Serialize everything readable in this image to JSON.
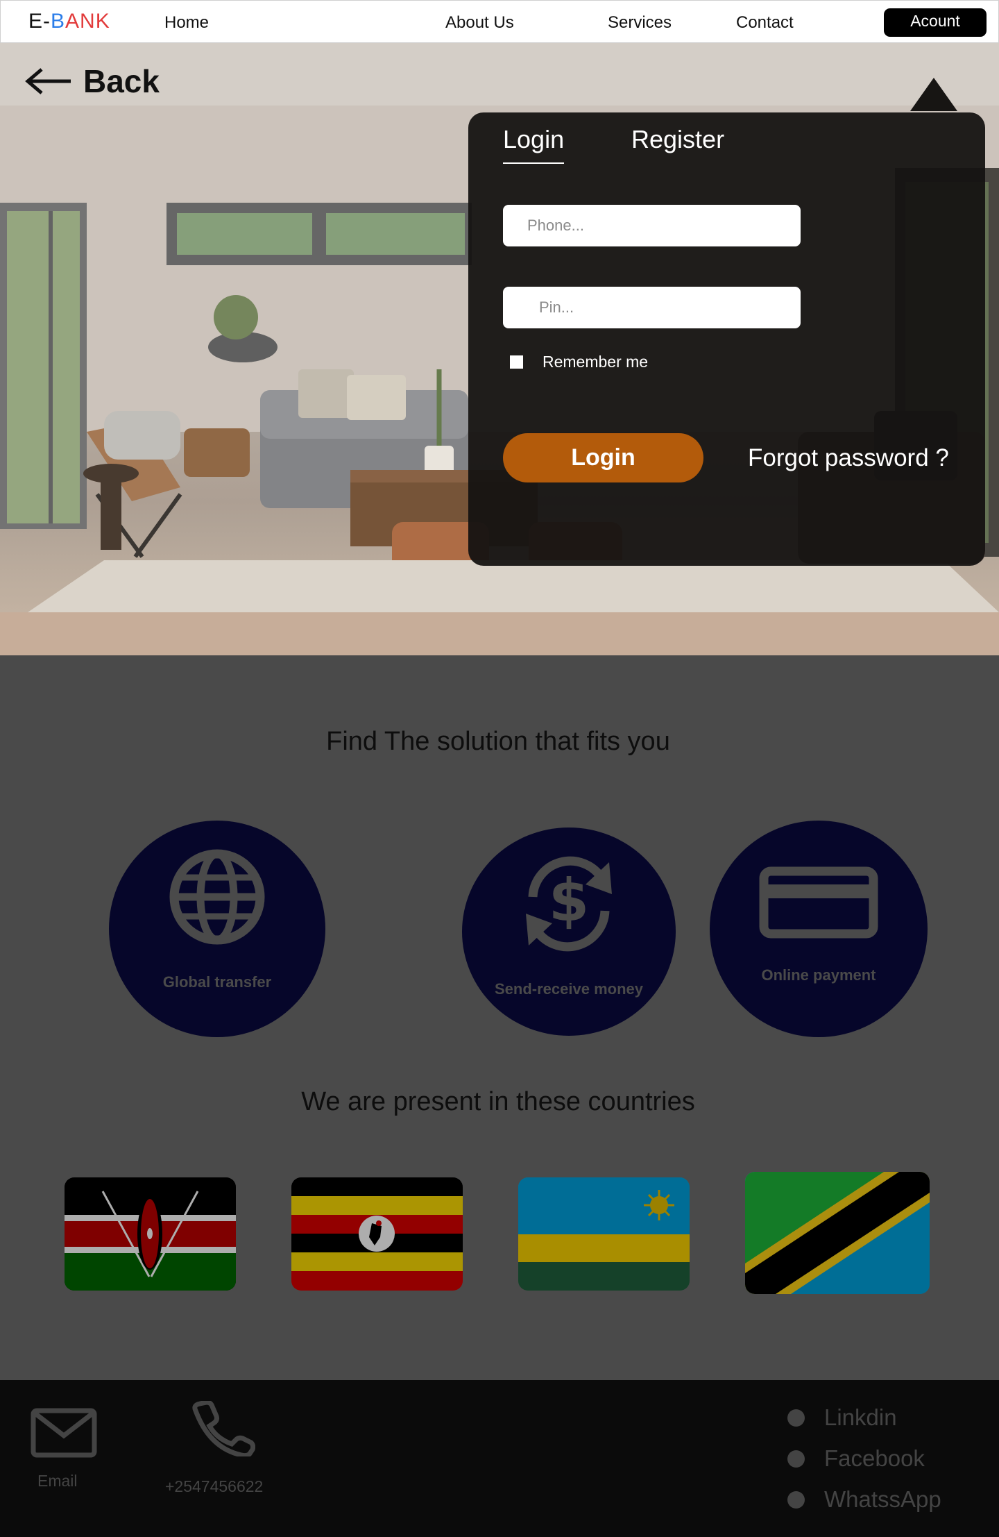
{
  "nav": {
    "logo": {
      "e": "E-",
      "b": "B",
      "a": "A",
      "nk": "NK"
    },
    "home": "Home",
    "about": "About Us",
    "services": "Services",
    "contact": "Contact",
    "account": "Acount"
  },
  "hero": {
    "back_label": "Back"
  },
  "login_panel": {
    "tab_login": "Login",
    "tab_register": "Register",
    "phone_placeholder": "Phone...",
    "pin_placeholder": "Pin...",
    "remember_label": "Remember me",
    "login_button": "Login",
    "forgot_password": "Forgot password ?"
  },
  "solutions": {
    "title": "Find The solution that fits you",
    "items": [
      {
        "label": "Global transfer",
        "icon": "globe-icon"
      },
      {
        "label": "Send-receive money",
        "icon": "dollar-exchange-icon"
      },
      {
        "label": "Online payment",
        "icon": "credit-card-icon"
      }
    ]
  },
  "countries": {
    "title": "We are present in these countries",
    "flags": [
      {
        "icon": "kenya-flag"
      },
      {
        "icon": "uganda-flag"
      },
      {
        "icon": "rwanda-flag"
      },
      {
        "icon": "tanzania-flag"
      }
    ]
  },
  "footer": {
    "email_label": "Email",
    "phone_number": "+2547456622",
    "socials": [
      "Linkdin",
      "Facebook",
      "WhatssApp"
    ]
  },
  "colors": {
    "accent": "#b35b0b",
    "circle": "#06062a",
    "logo_blue": "#2b7de9",
    "logo_red": "#e23b3b"
  }
}
